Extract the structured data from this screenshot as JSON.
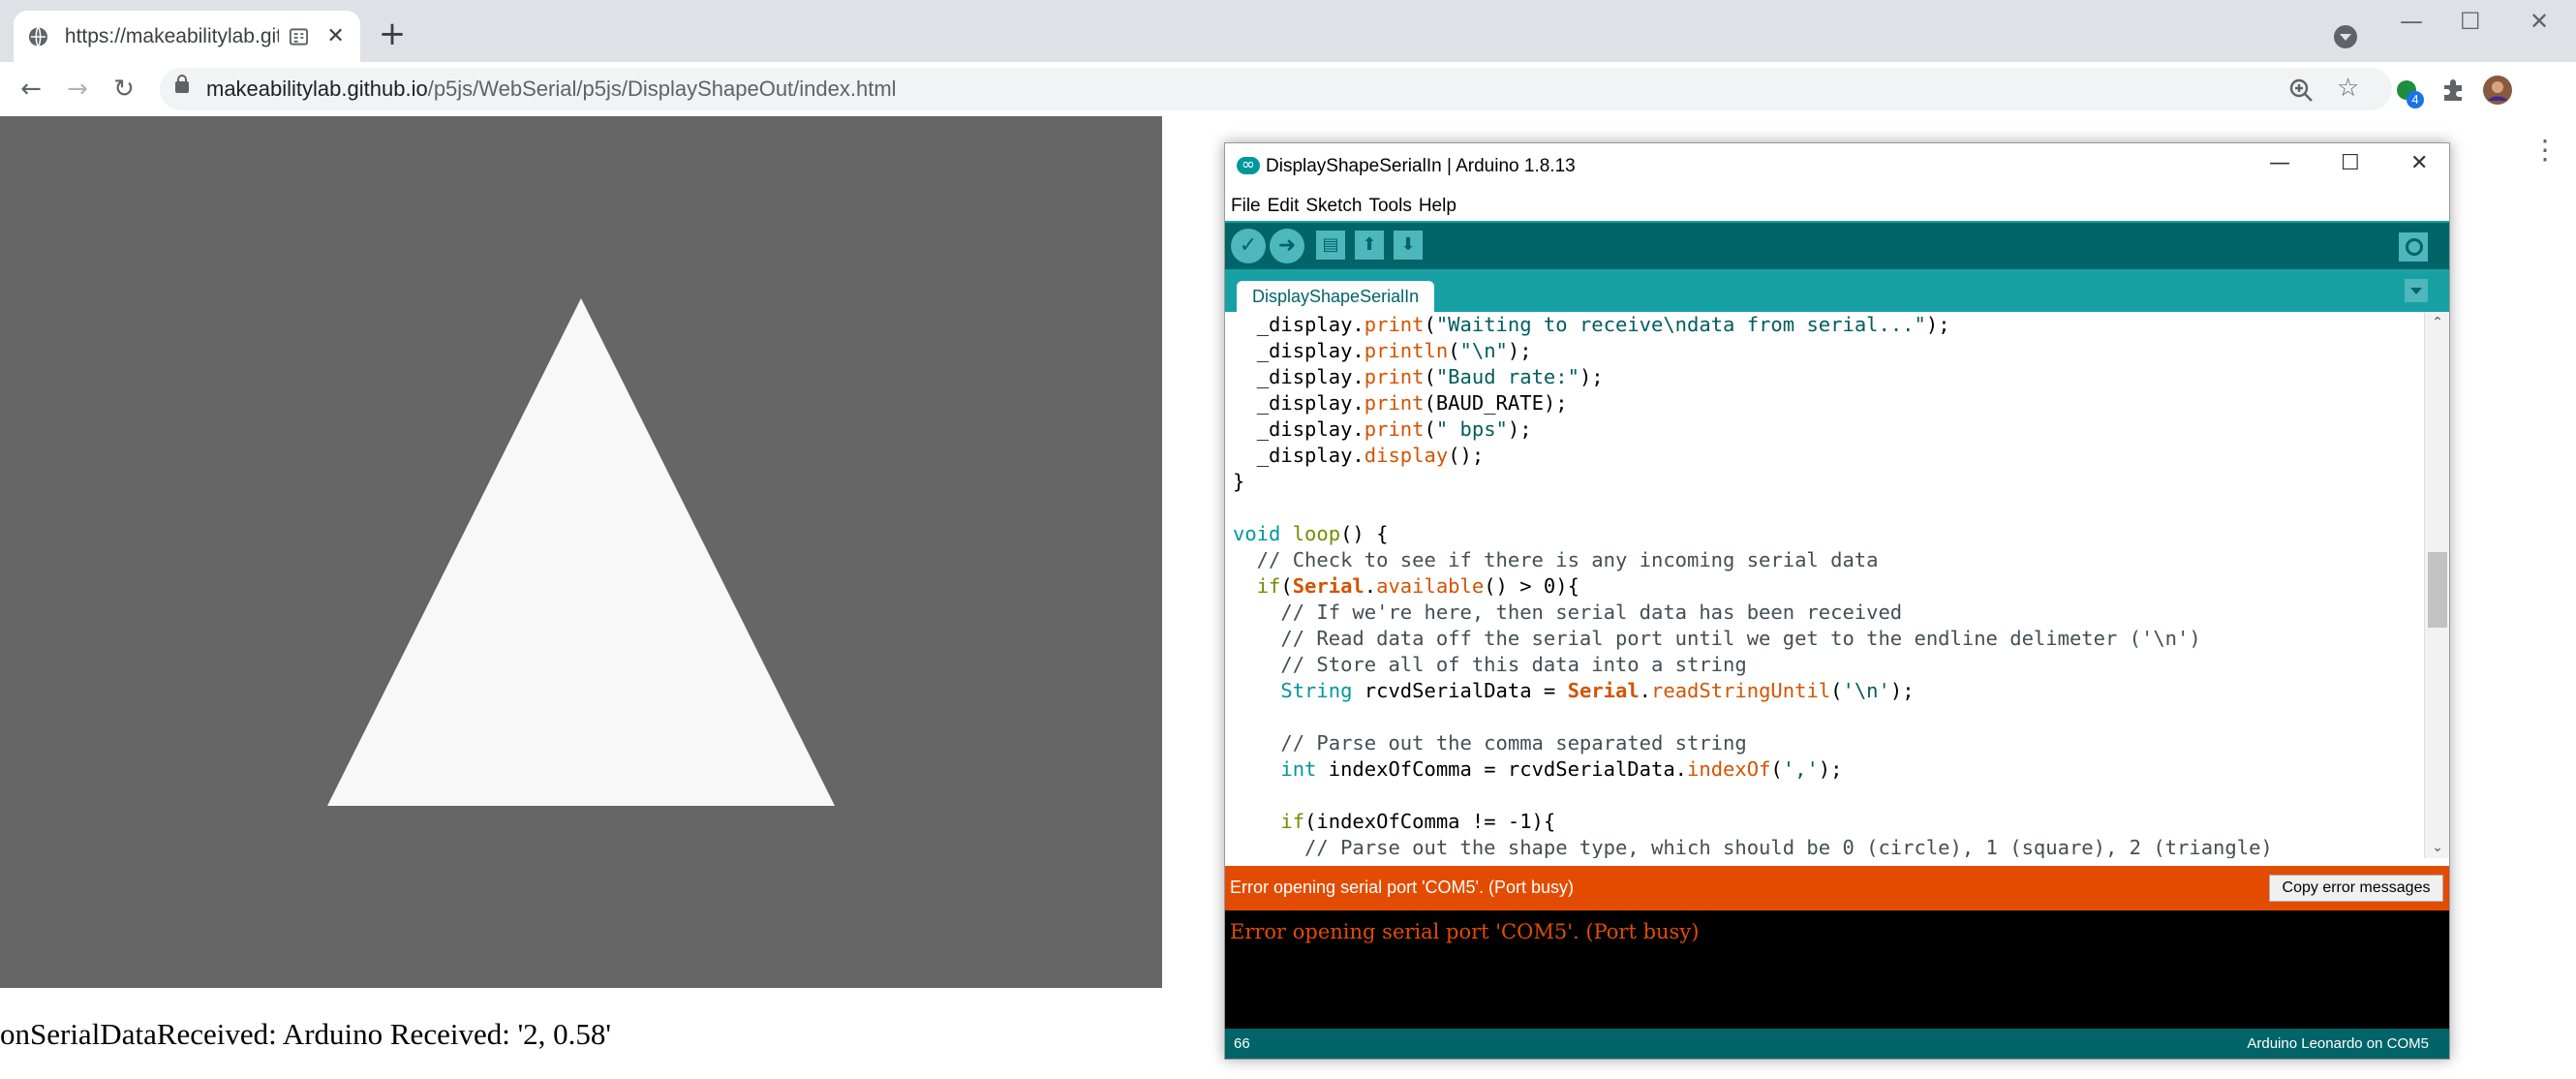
{
  "browser": {
    "tab": {
      "title": "https://makeabilitylab.githu",
      "close": "✕"
    },
    "new_tab": "+",
    "window_controls": {
      "minimize": "—",
      "maximize": "☐",
      "close": "✕"
    },
    "nav": {
      "back": "←",
      "forward": "→",
      "reload": "↻"
    },
    "url": {
      "host": "makeabilitylab.github.io",
      "path": "/p5js/WebSerial/p5js/DisplayShapeOut/index.html"
    },
    "star": "☆",
    "extension_badge": "4",
    "menu": "⋮",
    "icons": [
      "globe-icon",
      "reader-mode-icon",
      "zoom-icon",
      "star-icon",
      "extension-green-dot-icon",
      "puzzle-icon",
      "profile-avatar-icon"
    ]
  },
  "page": {
    "canvas": {
      "background": "#666666",
      "shape": "triangle",
      "shape_color": "#f8f8f8"
    },
    "status_text": "onSerialDataReceived: Arduino Received: '2, 0.58'"
  },
  "arduino": {
    "title": "DisplayShapeSerialIn | Arduino 1.8.13",
    "window_controls": {
      "minimize": "—",
      "maximize": "☐",
      "close": "✕"
    },
    "menu": [
      "File",
      "Edit",
      "Sketch",
      "Tools",
      "Help"
    ],
    "toolbar": {
      "verify": "✓",
      "upload": "➜",
      "new": "▤",
      "open": "⬆",
      "save": "⬇"
    },
    "tab": "DisplayShapeSerialIn",
    "code_lines": [
      [
        [
          "  ",
          ""
        ],
        [
          "_display.",
          ""
        ],
        [
          "print",
          "k-fn"
        ],
        [
          "(",
          ""
        ],
        [
          "\"Waiting to receive\\ndata from serial...\"",
          "k-str"
        ],
        [
          ");",
          ""
        ]
      ],
      [
        [
          "  ",
          ""
        ],
        [
          "_display.",
          ""
        ],
        [
          "println",
          "k-fn"
        ],
        [
          "(",
          ""
        ],
        [
          "\"\\n\"",
          "k-str"
        ],
        [
          ");",
          ""
        ]
      ],
      [
        [
          "  ",
          ""
        ],
        [
          "_display.",
          ""
        ],
        [
          "print",
          "k-fn"
        ],
        [
          "(",
          ""
        ],
        [
          "\"Baud rate:\"",
          "k-str"
        ],
        [
          ");",
          ""
        ]
      ],
      [
        [
          "  ",
          ""
        ],
        [
          "_display.",
          ""
        ],
        [
          "print",
          "k-fn"
        ],
        [
          "(BAUD_RATE);",
          ""
        ]
      ],
      [
        [
          "  ",
          ""
        ],
        [
          "_display.",
          ""
        ],
        [
          "print",
          "k-fn"
        ],
        [
          "(",
          ""
        ],
        [
          "\" bps\"",
          "k-str"
        ],
        [
          ");",
          ""
        ]
      ],
      [
        [
          "  ",
          ""
        ],
        [
          "_display.",
          ""
        ],
        [
          "display",
          "k-fn"
        ],
        [
          "();",
          ""
        ]
      ],
      [
        [
          "}",
          ""
        ]
      ],
      [
        [
          "",
          ""
        ]
      ],
      [
        [
          "void",
          "k-type"
        ],
        [
          " ",
          ""
        ],
        [
          "loop",
          "k-kw"
        ],
        [
          "() {",
          ""
        ]
      ],
      [
        [
          "  // Check to see if there is any incoming serial data",
          "k-cm"
        ]
      ],
      [
        [
          "  ",
          ""
        ],
        [
          "if",
          "k-kw"
        ],
        [
          "(",
          ""
        ],
        [
          "Serial",
          "k-ser"
        ],
        [
          ".",
          ""
        ],
        [
          "available",
          "k-fn"
        ],
        [
          "() > 0){",
          ""
        ]
      ],
      [
        [
          "    // If we're here, then serial data has been received",
          "k-cm"
        ]
      ],
      [
        [
          "    // Read data off the serial port until we get to the endline delimeter ('\\n')",
          "k-cm"
        ]
      ],
      [
        [
          "    // Store all of this data into a string",
          "k-cm"
        ]
      ],
      [
        [
          "    ",
          ""
        ],
        [
          "String",
          "k-type"
        ],
        [
          " rcvdSerialData = ",
          ""
        ],
        [
          "Serial",
          "k-ser"
        ],
        [
          ".",
          ""
        ],
        [
          "readStringUntil",
          "k-fn"
        ],
        [
          "(",
          ""
        ],
        [
          "'\\n'",
          "k-str"
        ],
        [
          ");",
          ""
        ]
      ],
      [
        [
          "",
          ""
        ]
      ],
      [
        [
          "    // Parse out the comma separated string",
          "k-cm"
        ]
      ],
      [
        [
          "    ",
          ""
        ],
        [
          "int",
          "k-type"
        ],
        [
          " indexOfComma = rcvdSerialData.",
          ""
        ],
        [
          "indexOf",
          "k-fn"
        ],
        [
          "(",
          ""
        ],
        [
          "','",
          "k-str"
        ],
        [
          ");",
          ""
        ]
      ],
      [
        [
          "",
          ""
        ]
      ],
      [
        [
          "    ",
          ""
        ],
        [
          "if",
          "k-kw"
        ],
        [
          "(indexOfComma != -1){",
          ""
        ]
      ],
      [
        [
          "      // Parse out the shape type, which should be 0 (circle), 1 (square), 2 (triangle)",
          "k-cm"
        ]
      ]
    ],
    "error_bar": "Error opening serial port 'COM5'. (Port busy)",
    "copy_button": "Copy error messages",
    "console_output": "Error opening serial port 'COM5'. (Port busy)",
    "status": {
      "line": "66",
      "board": "Arduino Leonardo on COM5"
    },
    "colors": {
      "teal_dark": "#006468",
      "teal": "#17a1a5",
      "error": "#e34c00"
    }
  }
}
